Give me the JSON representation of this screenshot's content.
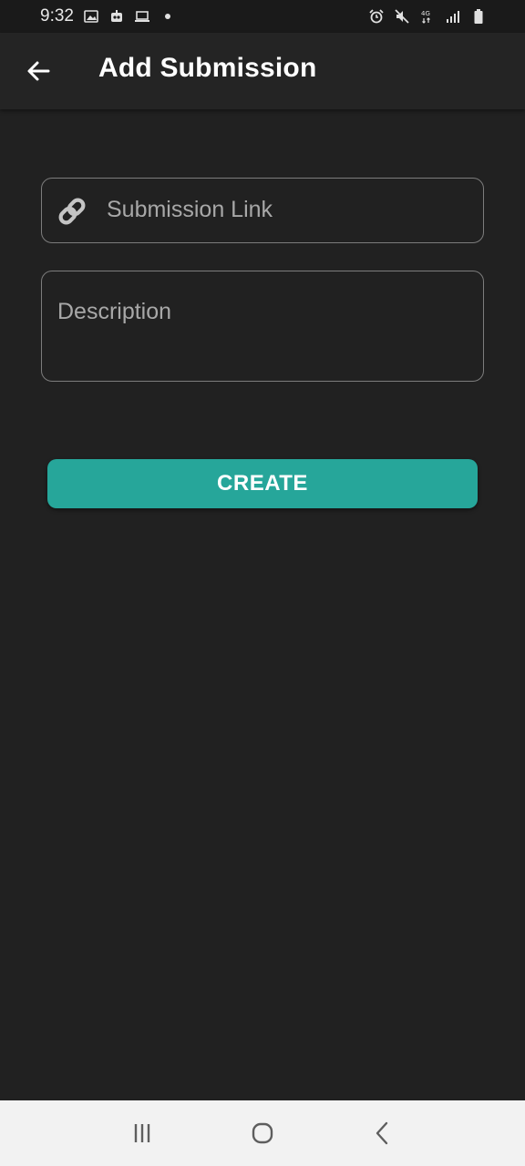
{
  "status_bar": {
    "time": "9:32",
    "left_icons": [
      "image-icon",
      "robot-icon",
      "laptop-icon",
      "dot-icon"
    ],
    "right_icons": [
      "alarm-icon",
      "mute-icon",
      "network-4g-icon",
      "signal-icon",
      "battery-icon"
    ],
    "network_label": "4G"
  },
  "app_bar": {
    "title": "Add Submission",
    "back_icon": "arrow-back-icon"
  },
  "form": {
    "link_placeholder": "Submission Link",
    "link_value": "",
    "link_icon": "link-icon",
    "description_placeholder": "Description",
    "description_value": ""
  },
  "actions": {
    "create_label": "CREATE"
  },
  "nav_bar": {
    "buttons": [
      "recents-icon",
      "home-icon",
      "back-icon"
    ]
  },
  "colors": {
    "background": "#212121",
    "app_bar": "#242424",
    "accent": "#26a69a",
    "field_border": "#7d7d7d",
    "placeholder": "#a8a8a8",
    "nav_bar": "#f2f2f2"
  }
}
